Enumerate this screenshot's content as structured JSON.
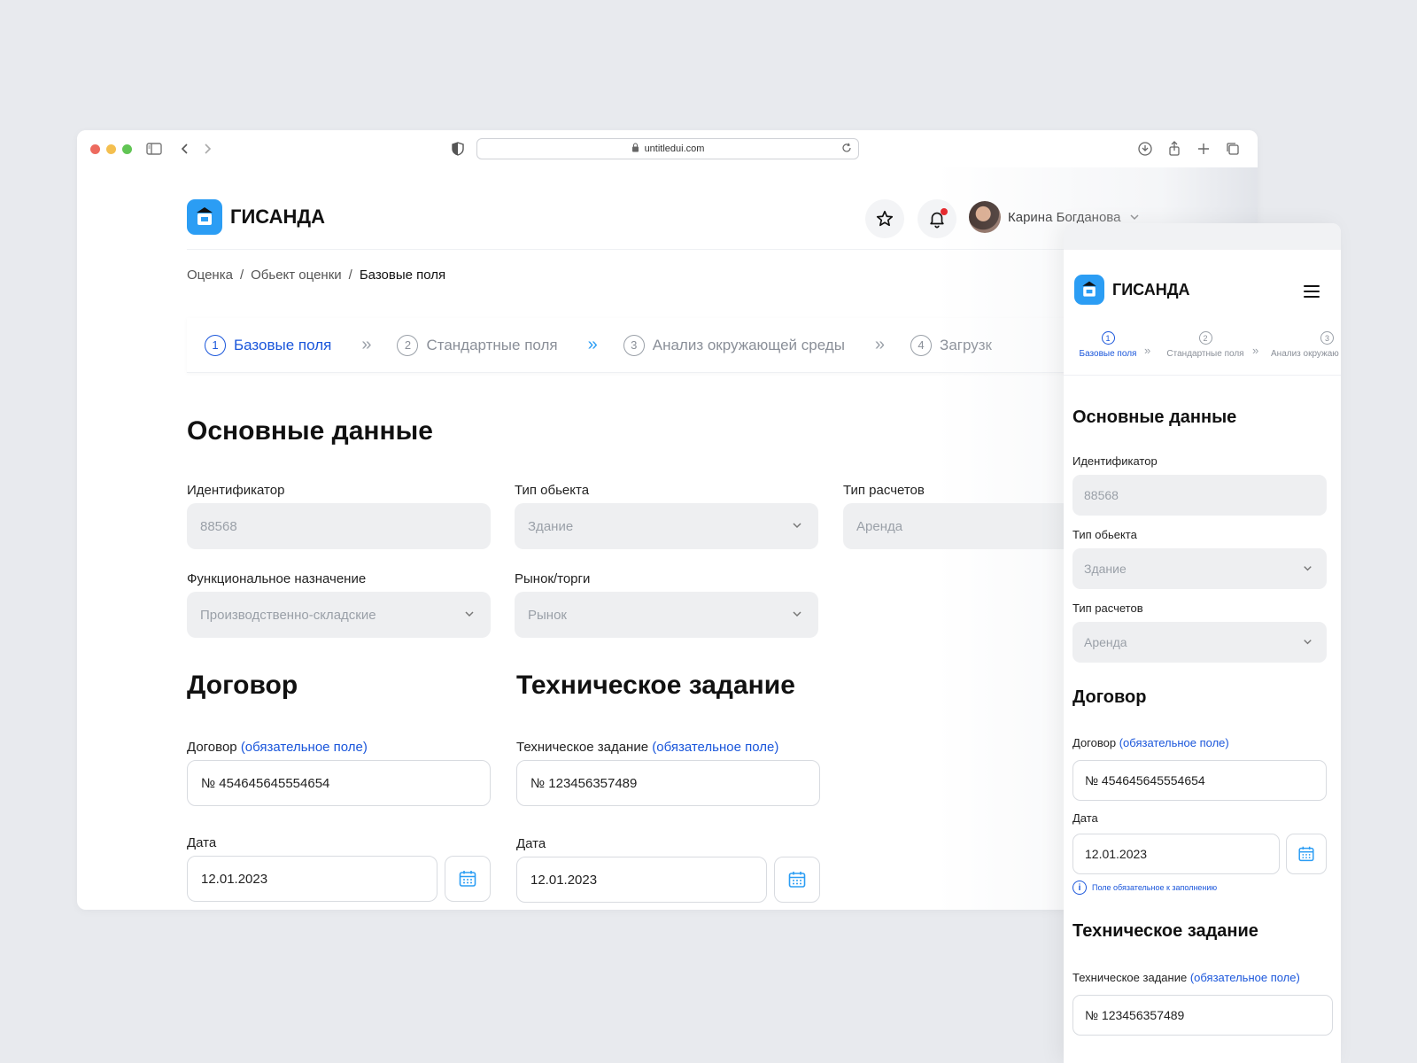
{
  "browser": {
    "url": "untitledui.com"
  },
  "app": {
    "brand": "ГИСАНДА",
    "user_name": "Карина Богданова"
  },
  "breadcrumb": {
    "items": [
      "Оценка",
      "Обьект оценки",
      "Базовые поля"
    ],
    "separator": "/"
  },
  "steps": [
    {
      "num": "1",
      "label": "Базовые поля",
      "active": true
    },
    {
      "num": "2",
      "label": "Стандартные поля",
      "active": false
    },
    {
      "num": "3",
      "label": "Анализ окружающей среды",
      "active": false
    },
    {
      "num": "4",
      "label": "Загрузк",
      "active": false
    }
  ],
  "step_separator": "»",
  "mobile_steps": [
    {
      "num": "1",
      "label": "Базовые поля"
    },
    {
      "num": "2",
      "label": "Стандартные поля"
    },
    {
      "num": "3",
      "label": "Анализ окружаю"
    }
  ],
  "basic": {
    "title": "Основные данные",
    "id_label": "Идентификатор",
    "id_value": "88568",
    "object_type_label": "Тип обьекта",
    "object_type_value": "Здание",
    "calc_type_label": "Тип расчетов",
    "calc_type_value": "Аренда",
    "purpose_label": "Функциональное назначение",
    "purpose_value": "Производственно-складские",
    "market_label": "Рынок/торги",
    "market_value": "Рынок"
  },
  "contract": {
    "title": "Договор",
    "label": "Договор",
    "required": "(обязательное поле)",
    "value": "№ 454645645554654",
    "date_label": "Дата",
    "date_value": "12.01.2023"
  },
  "tech": {
    "title": "Техническое задание",
    "label": "Техническое задание",
    "required": "(обязательное поле)",
    "value": "№ 123456357489",
    "date_label": "Дата",
    "date_value": "12.01.2023"
  },
  "mobile": {
    "hint": "Поле обязательное к заполнению",
    "hint_icon": "i"
  },
  "colors": {
    "accent": "#1a56db",
    "brand": "#2b9df4",
    "notification": "#e5252a"
  }
}
